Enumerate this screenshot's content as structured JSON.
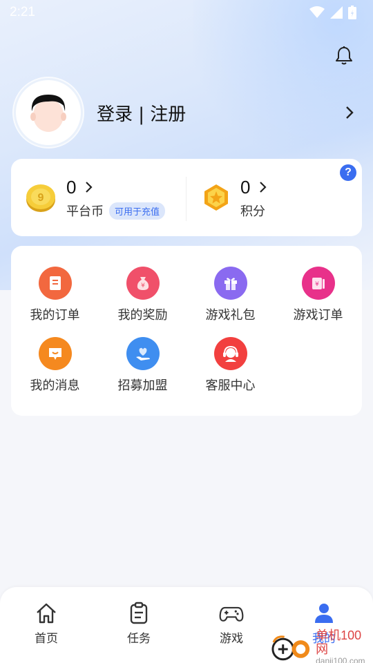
{
  "status_bar": {
    "time": "2:21"
  },
  "header": {
    "bell_icon": "bell-icon"
  },
  "profile": {
    "login_text": "登录 | 注册"
  },
  "wallet": {
    "coins": {
      "value": "0",
      "label": "平台币",
      "badge": "可用于充值"
    },
    "points": {
      "value": "0",
      "label": "积分"
    },
    "help_glyph": "?"
  },
  "services": [
    {
      "label": "我的订单",
      "icon": "order-icon",
      "color": "#f2683f"
    },
    {
      "label": "我的奖励",
      "icon": "reward-bag-icon",
      "color": "#f0506a"
    },
    {
      "label": "游戏礼包",
      "icon": "gift-icon",
      "color": "#8a6af0"
    },
    {
      "label": "游戏订单",
      "icon": "game-order-icon",
      "color": "#e8318a"
    },
    {
      "label": "我的消息",
      "icon": "message-icon",
      "color": "#f5891f"
    },
    {
      "label": "招募加盟",
      "icon": "recruit-icon",
      "color": "#3f8ef0"
    },
    {
      "label": "客服中心",
      "icon": "customer-service-icon",
      "color": "#f2403f"
    }
  ],
  "tab_bar": {
    "items": [
      {
        "label": "首页",
        "icon": "home-icon"
      },
      {
        "label": "任务",
        "icon": "task-icon"
      },
      {
        "label": "游戏",
        "icon": "gamepad-icon"
      },
      {
        "label": "我的",
        "icon": "profile-icon",
        "active": true
      }
    ]
  },
  "watermark": {
    "main": "单机100网",
    "sub": "danji100.com"
  },
  "colors": {
    "accent": "#3a6df0"
  }
}
